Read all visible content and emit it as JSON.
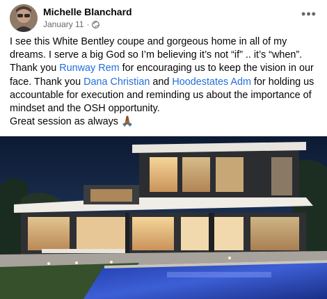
{
  "post": {
    "author": "Michelle Blanchard",
    "date": "January 11",
    "separator": "·",
    "privacy_icon": "globe-icon",
    "more_icon": "more-options-icon",
    "more_glyph": "•••",
    "text": {
      "p1": "I see this White Bentley coupe and gorgeous home in all of my dreams. I serve a big God so I’m believing it’s not “if” .. it’s “when”. Thank you ",
      "mention1": "Runway Rem",
      "p2": " for encouraging us to keep the vision in our face. Thank you ",
      "mention2": "Dana Christian",
      "p3": " and ",
      "mention3": "Hoodestates Adm",
      "p4": " for holding us accountable for execution and reminding us about the importance of mindset and the OSH opportunity.",
      "p5": "Great session as always ",
      "emoji": "🙏🏾"
    },
    "colors": {
      "link": "#216fdb",
      "meta": "#65676b"
    }
  }
}
